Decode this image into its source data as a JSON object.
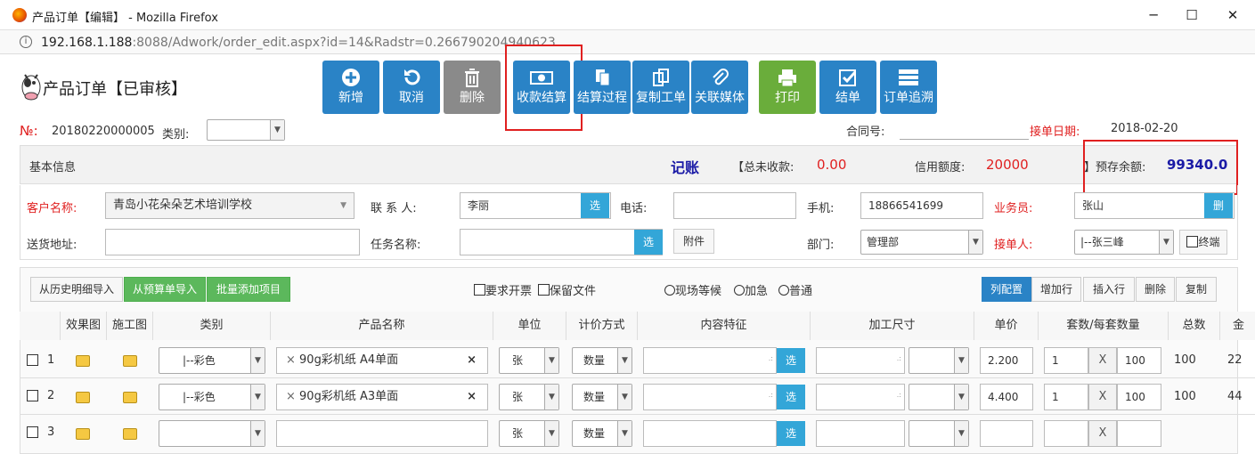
{
  "window": {
    "title": "产品订单【编辑】 - Mozilla Firefox",
    "min": "─",
    "max": "☐",
    "close": "✕"
  },
  "address": {
    "host": "192.168.1.188",
    "rest": ":8088/Adwork/order_edit.aspx?id=14&Radstr=0.266790204940623"
  },
  "page": {
    "title": "产品订单【已审核】"
  },
  "toolbar": [
    {
      "label": "新增",
      "icon": "plus-circle-icon"
    },
    {
      "label": "取消",
      "icon": "undo-icon"
    },
    {
      "label": "删除",
      "icon": "trash-icon"
    },
    {
      "label": "收款结算",
      "icon": "money-icon"
    },
    {
      "label": "结算过程",
      "icon": "copy-doc-icon"
    },
    {
      "label": "复制工单",
      "icon": "copy-icon"
    },
    {
      "label": "关联媒体",
      "icon": "paperclip-icon"
    },
    {
      "label": "打印",
      "icon": "print-icon"
    },
    {
      "label": "结单",
      "icon": "check-square-icon"
    },
    {
      "label": "订单追溯",
      "icon": "list-icon"
    }
  ],
  "order": {
    "no_label": "№:",
    "no": "20180220000005",
    "type_label": "类别:",
    "type_value": "",
    "contract_label": "合同号:",
    "contract_value": "",
    "date_label": "接单日期:",
    "date": "2018-02-20"
  },
  "summary": {
    "section": "基本信息",
    "bookkeeping": "记账",
    "unpaid_label": "【总未收款:",
    "unpaid": "0.00",
    "credit_label": "信用额度:",
    "credit": "20000",
    "balance_label": "】预存余额:",
    "balance": "99340.0"
  },
  "form": {
    "customer_label": "客户名称:",
    "customer": "青岛小花朵朵艺术培训学校",
    "contact_label": "联 系 人:",
    "contact": "李丽",
    "choose": "选",
    "phone_label": "电话:",
    "phone": "",
    "mobile_label": "手机:",
    "mobile": "18866541699",
    "sales_label": "业务员:",
    "sales": "张山",
    "delete_short": "删",
    "address_label": "送货地址:",
    "address": "",
    "task_label": "任务名称:",
    "task": "",
    "attach": "附件",
    "dept_label": "部门:",
    "dept": "管理部",
    "receiver_label": "接单人:",
    "receiver": "|--张三峰",
    "terminal": "终端"
  },
  "import": {
    "history": "从历史明细导入",
    "budget": "从预算单导入",
    "batch": "批量添加项目"
  },
  "options": {
    "invoice": "要求开票",
    "keepfile": "保留文件",
    "onsite": "现场等候",
    "urgent": "加急",
    "normal": "普通"
  },
  "rowbtns": {
    "columns": "列配置",
    "add": "增加行",
    "insert": "插入行",
    "delete": "删除",
    "copy": "复制"
  },
  "columns": [
    "效果图",
    "施工图",
    "类别",
    "产品名称",
    "单位",
    "计价方式",
    "内容特征",
    "加工尺寸",
    "单价",
    "套数/每套数量",
    "总数",
    "金"
  ],
  "rows": [
    {
      "n": "1",
      "cat": "|--彩色",
      "product": "90g彩机纸 A4单面",
      "unit": "张",
      "pricing": "数量",
      "price": "2.200",
      "sets": "1",
      "x": "X",
      "per": "100",
      "total": "100",
      "amt": "22"
    },
    {
      "n": "2",
      "cat": "|--彩色",
      "product": "90g彩机纸 A3单面",
      "unit": "张",
      "pricing": "数量",
      "price": "4.400",
      "sets": "1",
      "x": "X",
      "per": "100",
      "total": "100",
      "amt": "44"
    },
    {
      "n": "3",
      "cat": "",
      "product": "",
      "unit": "张",
      "pricing": "数量",
      "price": "",
      "sets": "",
      "x": "X",
      "per": "",
      "total": "",
      "amt": ""
    }
  ],
  "colors": {
    "blue": "#2a83c6",
    "green": "#6aad3b",
    "red": "#e02020",
    "highlight": "#1a1aa6"
  }
}
